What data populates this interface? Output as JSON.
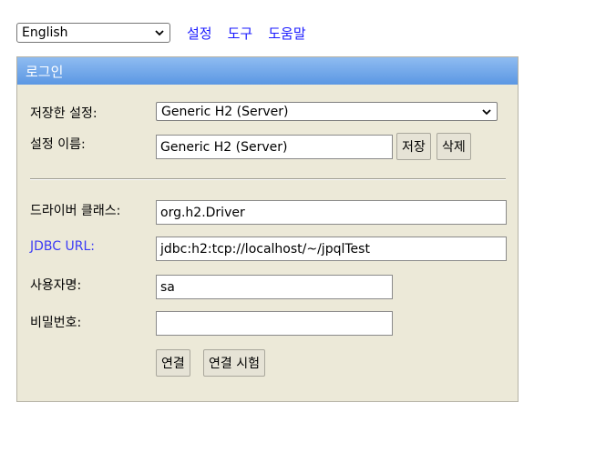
{
  "language": {
    "selected": "English"
  },
  "top_links": [
    "설정",
    "도구",
    "도움말"
  ],
  "panel": {
    "title": "로그인",
    "saved_settings_label": "저장한 설정:",
    "saved_settings_value": "Generic H2 (Server)",
    "setting_name_label": "설정 이름:",
    "setting_name_value": "Generic H2 (Server)",
    "save_button": "저장",
    "delete_button": "삭제",
    "driver_class_label": "드라이버 클래스:",
    "driver_class_value": "org.h2.Driver",
    "jdbc_url_label": "JDBC URL:",
    "jdbc_url_value": "jdbc:h2:tcp://localhost/~/jpqlTest",
    "username_label": "사용자명:",
    "username_value": "sa",
    "password_label": "비밀번호:",
    "password_value": "",
    "connect_button": "연결",
    "test_connect_button": "연결 시험"
  },
  "colors": {
    "link": "#1a1aff",
    "panel_bg": "#ece9d8",
    "header_top": "#8fbcf1",
    "header_bottom": "#5b97e3"
  }
}
